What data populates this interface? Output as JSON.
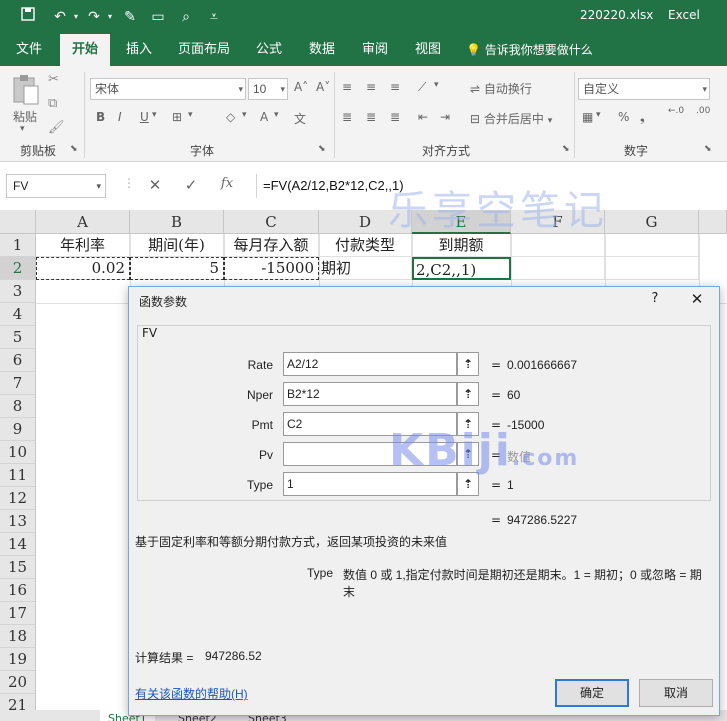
{
  "window": {
    "title": "220220.xlsx",
    "app": "Excel"
  },
  "qat": {
    "save_icon": "save-icon",
    "undo_icon": "undo-icon",
    "redo_icon": "redo-icon"
  },
  "tabs": [
    {
      "label": "文件"
    },
    {
      "label": "开始",
      "active": true
    },
    {
      "label": "插入"
    },
    {
      "label": "页面布局"
    },
    {
      "label": "公式"
    },
    {
      "label": "数据"
    },
    {
      "label": "审阅"
    },
    {
      "label": "视图"
    }
  ],
  "tell_me": "告诉我你想要做什么",
  "ribbon": {
    "paste_label": "粘贴",
    "clipboard_label": "剪贴板",
    "font_name": "宋体",
    "font_size": "10",
    "font_label": "字体",
    "wrap_text": "自动换行",
    "merge_center": "合并后居中",
    "alignment_label": "对齐方式",
    "number_format": "自定义",
    "number_label": "数字"
  },
  "formula_bar": {
    "name_box": "FV",
    "cancel": "✕",
    "enter": "✓",
    "fx": "fx",
    "formula": "=FV(A2/12,B2*12,C2,,1)"
  },
  "grid": {
    "columns": [
      "A",
      "B",
      "C",
      "D",
      "E",
      "F",
      "G"
    ],
    "rows": [
      "1",
      "2",
      "3",
      "4",
      "5",
      "6",
      "7",
      "8",
      "9",
      "10",
      "11",
      "12",
      "13",
      "14",
      "15",
      "16",
      "17",
      "18",
      "19",
      "20",
      "21"
    ],
    "row1": [
      "年利率",
      "期间(年)",
      "每月存入额",
      "付款类型",
      "到期额"
    ],
    "row2": [
      "0.02",
      "5",
      "-15000",
      "期初",
      "2,C2,,1)"
    ]
  },
  "watermark": "乐享空笔记",
  "sheet_tabs": [
    "Sheet1",
    "Sheet2",
    "Sheet3"
  ],
  "dialog": {
    "title": "函数参数",
    "help": "?",
    "close": "✕",
    "function_name": "FV",
    "args": [
      {
        "label": "Rate",
        "value": "A2/12",
        "result": "0.001666667"
      },
      {
        "label": "Nper",
        "value": "B2*12",
        "result": "60"
      },
      {
        "label": "Pmt",
        "value": "C2",
        "result": "-15000"
      },
      {
        "label": "Pv",
        "value": "",
        "result": "数值"
      },
      {
        "label": "Type",
        "value": "1",
        "result": "1"
      }
    ],
    "total_eq": "=",
    "total_result": "947286.5227",
    "description": "基于固定利率和等额分期付款方式，返回某项投资的未来值",
    "param_name": "Type",
    "param_desc_line1": "数值 0 或 1,指定付款时间是期初还是期末。1 = 期初；0 或忽略 = 期",
    "param_desc_line2": "末",
    "calc_label": "计算结果 =",
    "calc_value": "947286.52",
    "help_link": "有关该函数的帮助(H)",
    "ok": "确定",
    "cancel": "取消",
    "watermark": "KBiji",
    "watermark_suffix": ".com"
  }
}
